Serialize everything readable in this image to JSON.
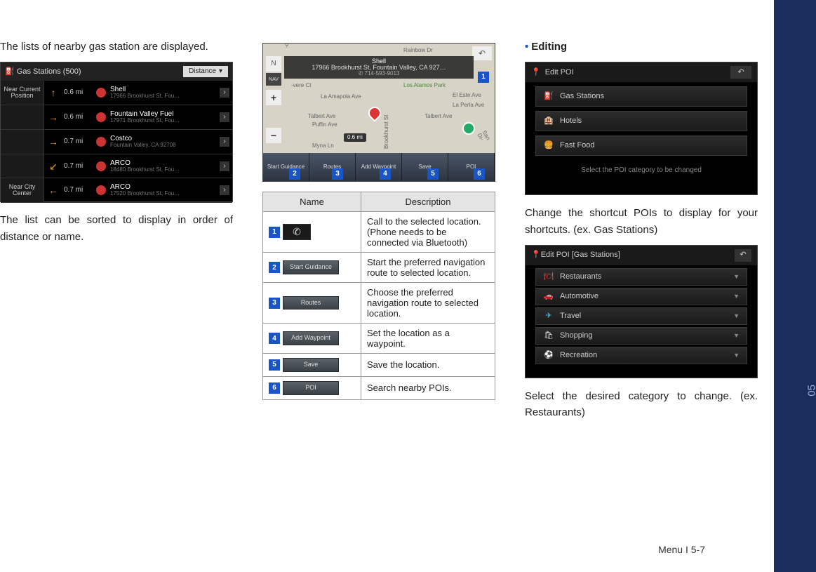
{
  "side_tab": "05",
  "footer": "Menu I 5-7",
  "col1": {
    "p1": "The lists of nearby gas station are displayed.",
    "p2": "The list can be sorted to display in order of distance or name.",
    "shot1": {
      "title_icon": "⛽",
      "title": "Gas Stations (500)",
      "sort": "Distance",
      "left_buttons": [
        "Near Current Position",
        "",
        "",
        "",
        "Near City Center"
      ],
      "rows": [
        {
          "arrow": "↑",
          "dist": "0.6 mi",
          "name": "Shell",
          "addr": "17966 Brookhurst St, Fou…"
        },
        {
          "arrow": "→",
          "dist": "0.6 mi",
          "name": "Fountain Valley Fuel",
          "addr": "17971 Brookhurst St, Fou…"
        },
        {
          "arrow": "→",
          "dist": "0.7 mi",
          "name": "Costco",
          "addr": "Fountain Valley, CA 92708"
        },
        {
          "arrow": "↙",
          "dist": "0.7 mi",
          "name": "ARCO",
          "addr": "18480 Brookhurst St, Fou…"
        },
        {
          "arrow": "←",
          "dist": "0.7 mi",
          "name": "ARCO",
          "addr": "17520 Brookhurst St, Fou…"
        }
      ]
    }
  },
  "col2": {
    "map": {
      "top_street": "Rainbow Dr",
      "poi_name": "Shell",
      "addr": "17966 Brookhurst St, Fountain Valley, CA 927…",
      "phone": "✆ 714-593-9013",
      "park": "Los Alamos Park",
      "streets": [
        "La Amapola Ave",
        "El Este Ave",
        "La Perla Ave",
        "Talbert Ave",
        "Talbert Ave",
        "Puffin Ave",
        "Myna Ln",
        "-vere Ct",
        "San Di-",
        "-out St",
        "Brookhurst St"
      ],
      "dist": "0.6 mi",
      "back": "↶",
      "compass": "N",
      "nav": "NAV",
      "zoom_in": "+",
      "zoom_out": "−",
      "callout_num": "1",
      "bottom_nums": [
        "2",
        "3",
        "4",
        "5",
        "6"
      ],
      "tabs": [
        "Start Guidance",
        "Routes",
        "Add Waypoint",
        "Save",
        "POI"
      ]
    },
    "table": {
      "head_name": "Name",
      "head_desc": "Description",
      "rows": [
        {
          "num": "1",
          "btn": "✆",
          "btn_class": "call",
          "desc": "Call to the selected location. (Phone needs to be connected via Bluetooth)"
        },
        {
          "num": "2",
          "btn": "Start Guidance",
          "desc": "Start the preferred navigation route to selected location."
        },
        {
          "num": "3",
          "btn": "Routes",
          "desc": "Choose the preferred navigation route to selected location."
        },
        {
          "num": "4",
          "btn": "Add Waypoint",
          "desc": "Set the location as a waypoint."
        },
        {
          "num": "5",
          "btn": "Save",
          "desc": "Save the location."
        },
        {
          "num": "6",
          "btn": "POI",
          "desc": "Search nearby POIs."
        }
      ]
    }
  },
  "col3": {
    "heading_bullet": "•",
    "heading": "Editing",
    "p1": "Change the shortcut POIs to display for your shortcuts. (ex. Gas Stations)",
    "p2": "Select the desired category to change. (ex. Restaurants)",
    "shot3": {
      "title": "Edit POI",
      "back": "↶",
      "items": [
        {
          "icon": "⛽",
          "cls": "ico-red",
          "label": "Gas Stations"
        },
        {
          "icon": "🏨",
          "cls": "ico-blue",
          "label": "Hotels"
        },
        {
          "icon": "🍔",
          "cls": "ico-red",
          "label": "Fast Food"
        }
      ],
      "msg": "Select the POI category to be changed"
    },
    "shot4": {
      "title": "Edit POI [Gas Stations]",
      "back": "↶",
      "items": [
        {
          "icon": "🍽",
          "cls": "ico-red",
          "label": "Restaurants"
        },
        {
          "icon": "🚗",
          "cls": "ico-white",
          "label": "Automotive"
        },
        {
          "icon": "✈",
          "cls": "ico-blue",
          "label": "Travel"
        },
        {
          "icon": "🛍",
          "cls": "ico-white",
          "label": "Shopping"
        },
        {
          "icon": "⚽",
          "cls": "ico-green",
          "label": "Recreation"
        }
      ]
    }
  }
}
